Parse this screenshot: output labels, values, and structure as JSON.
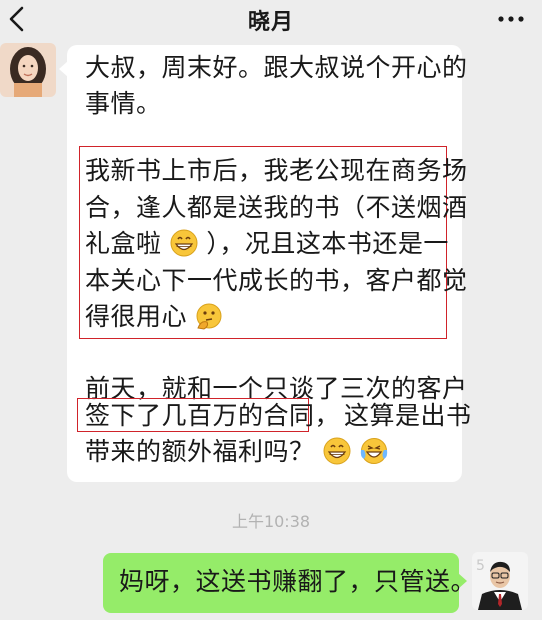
{
  "header": {
    "title": "晓月"
  },
  "time_divider": "上午10:38",
  "incoming_message": {
    "lines": [
      "大叔，周末好。跟大叔说个开心的",
      "事情。",
      "我新书上市后，我老公现在商务场",
      "合，逢人都是送我的书（不送烟酒",
      "礼盒啦",
      "），况且这本书还是一",
      "本关心下一代成长的书，客户都觉",
      "得很用心",
      "前天，就和一个只谈了三次的客户",
      "签下了几百万的合同，",
      "这算是出书",
      "带来的额外福利吗？"
    ],
    "emojis": [
      "grin-emoji",
      "thinking-emoji",
      "grin-emoji",
      "laughing-tears-emoji"
    ],
    "highlight_color": "#d0232a"
  },
  "outgoing_message": {
    "text": "妈呀，这送书赚翻了，只管送。"
  },
  "colors": {
    "background": "#ededed",
    "incoming_bubble": "#ffffff",
    "outgoing_bubble": "#95ec69"
  }
}
